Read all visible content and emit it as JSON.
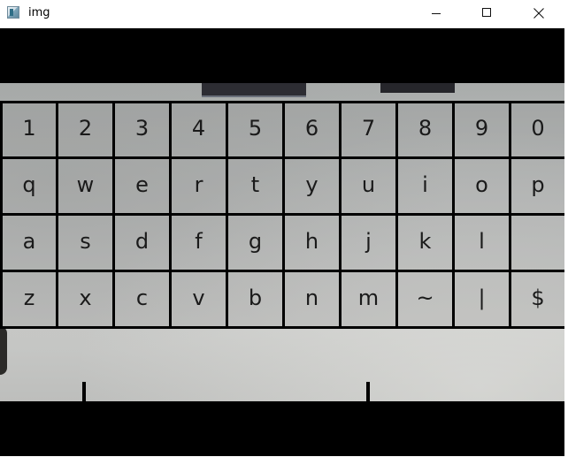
{
  "window": {
    "title": "img",
    "icon": "opencv-window-icon",
    "controls": [
      "minimize-icon",
      "maximize-icon",
      "close-icon"
    ]
  },
  "keyboard": {
    "rows": [
      [
        "1",
        "2",
        "3",
        "4",
        "5",
        "6",
        "7",
        "8",
        "9",
        "0"
      ],
      [
        "q",
        "w",
        "e",
        "r",
        "t",
        "y",
        "u",
        "i",
        "o",
        "p"
      ],
      [
        "a",
        "s",
        "d",
        "f",
        "g",
        "h",
        "j",
        "k",
        "l",
        ""
      ],
      [
        "z",
        "x",
        "c",
        "v",
        "b",
        "n",
        "m",
        "~",
        "|",
        "$"
      ]
    ],
    "space_label": ""
  },
  "colors": {
    "grid_line": "#000000",
    "key_text": "#1a1a1a",
    "letterbox": "#000000"
  }
}
